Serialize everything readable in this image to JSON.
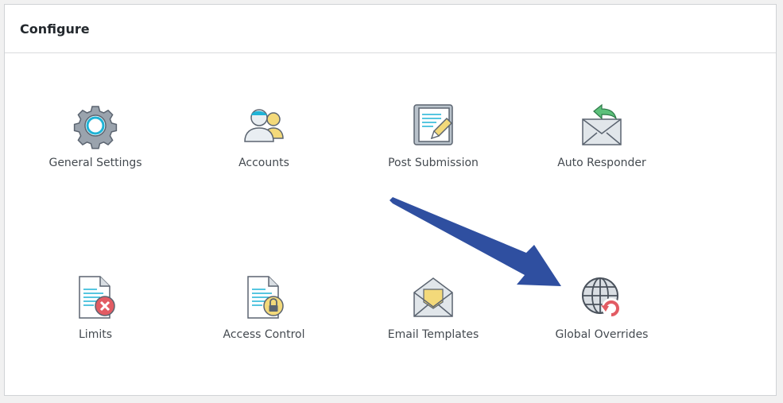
{
  "panel": {
    "title": "Configure"
  },
  "tiles": [
    {
      "label": "General Settings",
      "icon": "gear-icon"
    },
    {
      "label": "Accounts",
      "icon": "users-icon"
    },
    {
      "label": "Post Submission",
      "icon": "document-edit-icon"
    },
    {
      "label": "Auto Responder",
      "icon": "envelope-reply-icon"
    },
    {
      "label": "Limits",
      "icon": "document-x-icon"
    },
    {
      "label": "Access Control",
      "icon": "document-lock-icon"
    },
    {
      "label": "Email Templates",
      "icon": "open-envelope-icon"
    },
    {
      "label": "Global Overrides",
      "icon": "globe-refresh-icon"
    }
  ],
  "annotation": {
    "arrow_color": "#2f4fa0",
    "points_to": "Global Overrides"
  }
}
